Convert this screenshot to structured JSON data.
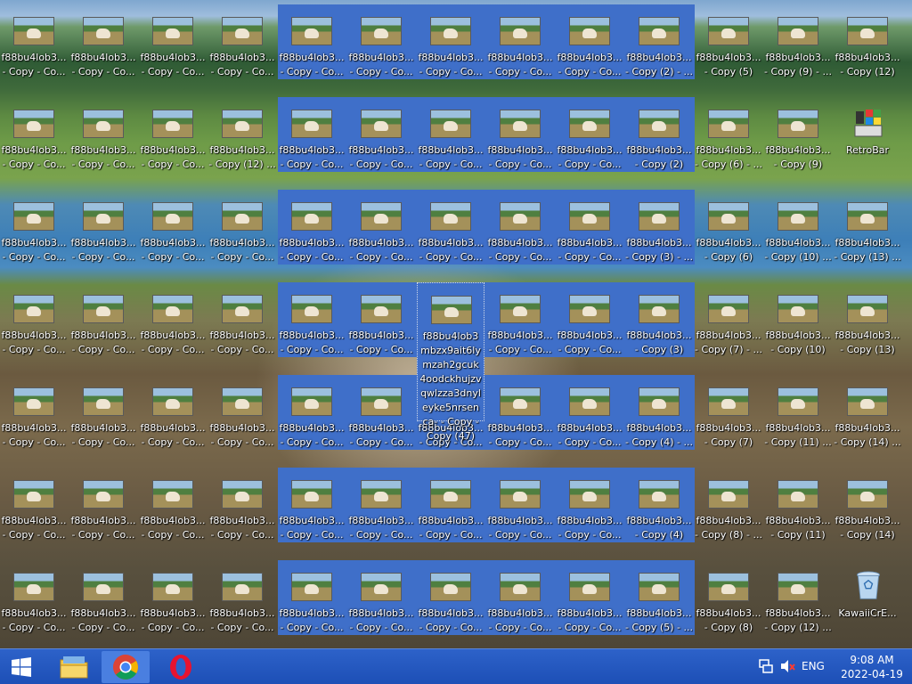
{
  "desktop": {
    "icon_name_full": "f88bu4lob3mbzx9ait6lymzah2gcuk4oodckhujzvqwlzza3dnyleyke5nrsenca- - Copy - Copy (47)",
    "rows": [
      [
        "f88bu4lob3...\n- Copy - Co...",
        "f88bu4lob3...\n- Copy - Co...",
        "f88bu4lob3...\n- Copy - Co...",
        "f88bu4lob3...\n- Copy - Co...",
        "f88bu4lob3...\n- Copy - Co...",
        "f88bu4lob3...\n- Copy - Co...",
        "f88bu4lob3...\n- Copy - Co...",
        "f88bu4lob3...\n- Copy - Co...",
        "f88bu4lob3...\n- Copy - Co...",
        "f88bu4lob3...\n- Copy (2) - ...",
        "f88bu4lob3...\n- Copy (5)",
        "f88bu4lob3...\n- Copy (9) - ...",
        "f88bu4lob3...\n- Copy (12)"
      ],
      [
        "f88bu4lob3...\n- Copy - Co...",
        "f88bu4lob3...\n- Copy - Co...",
        "f88bu4lob3...\n- Copy - Co...",
        "f88bu4lob3...\n- Copy (12) ...",
        "f88bu4lob3...\n- Copy - Co...",
        "f88bu4lob3...\n- Copy - Co...",
        "f88bu4lob3...\n- Copy - Co...",
        "f88bu4lob3...\n- Copy - Co...",
        "f88bu4lob3...\n- Copy - Co...",
        "f88bu4lob3...\n- Copy (2)",
        "f88bu4lob3...\n- Copy (6) - ...",
        "f88bu4lob3...\n- Copy (9)",
        "RetroBar"
      ],
      [
        "f88bu4lob3...\n- Copy - Co...",
        "f88bu4lob3...\n- Copy - Co...",
        "f88bu4lob3...\n- Copy - Co...",
        "f88bu4lob3...\n- Copy - Co...",
        "f88bu4lob3...\n- Copy - Co...",
        "f88bu4lob3...\n- Copy - Co...",
        "f88bu4lob3...\n- Copy - Co...",
        "f88bu4lob3...\n- Copy - Co...",
        "f88bu4lob3...\n- Copy - Co...",
        "f88bu4lob3...\n- Copy (3) - ...",
        "f88bu4lob3...\n- Copy (6)",
        "f88bu4lob3...\n- Copy (10) ...",
        "f88bu4lob3...\n- Copy (13) ..."
      ],
      [
        "f88bu4lob3...\n- Copy - Co...",
        "f88bu4lob3...\n- Copy - Co...",
        "f88bu4lob3...\n- Copy - Co...",
        "f88bu4lob3...\n- Copy - Co...",
        "f88bu4lob3...\n- Copy - Co...",
        "f88bu4lob3...\n- Copy - Co...",
        "f88bu4lob3mbzx9ait6lymzah2gcuk4oodckhujzvqwlzza3dnyleyke5nrsenca- - Copy - Copy (47)",
        "f88bu4lob3...\n- Copy - Co...",
        "f88bu4lob3...\n- Copy - Co...",
        "f88bu4lob3...\n- Copy (3)",
        "f88bu4lob3...\n- Copy (7) - ...",
        "f88bu4lob3...\n- Copy (10)",
        "f88bu4lob3...\n- Copy (13)"
      ],
      [
        "f88bu4lob3...\n- Copy - Co...",
        "f88bu4lob3...\n- Copy - Co...",
        "f88bu4lob3...\n- Copy - Co...",
        "f88bu4lob3...\n- Copy - Co...",
        "f88bu4lob3...\n- Copy - Co...",
        "f88bu4lob3...\n- Copy - Co...",
        "f88bu4lob3...\n- Copy - Co...",
        "f88bu4lob3...\n- Copy - Co...",
        "f88bu4lob3...\n- Copy - Co...",
        "f88bu4lob3...\n- Copy (4) - ...",
        "f88bu4lob3...\n- Copy (7)",
        "f88bu4lob3...\n- Copy (11) ...",
        "f88bu4lob3...\n- Copy (14) ..."
      ],
      [
        "f88bu4lob3...\n- Copy - Co...",
        "f88bu4lob3...\n- Copy - Co...",
        "f88bu4lob3...\n- Copy - Co...",
        "f88bu4lob3...\n- Copy - Co...",
        "f88bu4lob3...\n- Copy - Co...",
        "f88bu4lob3...\n- Copy - Co...",
        "f88bu4lob3...\n- Copy - Co...",
        "f88bu4lob3...\n- Copy - Co...",
        "f88bu4lob3...\n- Copy - Co...",
        "f88bu4lob3...\n- Copy (4)",
        "f88bu4lob3...\n- Copy (8) - ...",
        "f88bu4lob3...\n- Copy (11)",
        "f88bu4lob3...\n- Copy (14)"
      ],
      [
        "f88bu4lob3...\n- Copy - Co...",
        "f88bu4lob3...\n- Copy - Co...",
        "f88bu4lob3...\n- Copy - Co...",
        "f88bu4lob3...\n- Copy - Co...",
        "f88bu4lob3...\n- Copy - Co...",
        "f88bu4lob3...\n- Copy - Co...",
        "f88bu4lob3...\n- Copy - Co...",
        "f88bu4lob3...\n- Copy - Co...",
        "f88bu4lob3...\n- Copy - Co...",
        "f88bu4lob3...\n- Copy (5) - ...",
        "f88bu4lob3...\n- Copy (8)",
        "f88bu4lob3...\n- Copy (12) ...",
        "KawaiiCrE..."
      ]
    ],
    "special": {
      "retrobar_label": "RetroBar",
      "recycle_label": "KawaiiCrE..."
    }
  },
  "taskbar": {
    "start_icon": "windows-logo-icon",
    "apps": [
      "file-explorer-icon",
      "chrome-icon",
      "opera-icon"
    ],
    "tray": {
      "network_icon": "network-icon",
      "volume_icon": "volume-muted-icon",
      "language": "ENG"
    },
    "clock": {
      "time": "9:08 AM",
      "date": "2022-04-19"
    }
  },
  "colors": {
    "selection": "#3f6fc9",
    "taskbar": "#2d62c9"
  }
}
